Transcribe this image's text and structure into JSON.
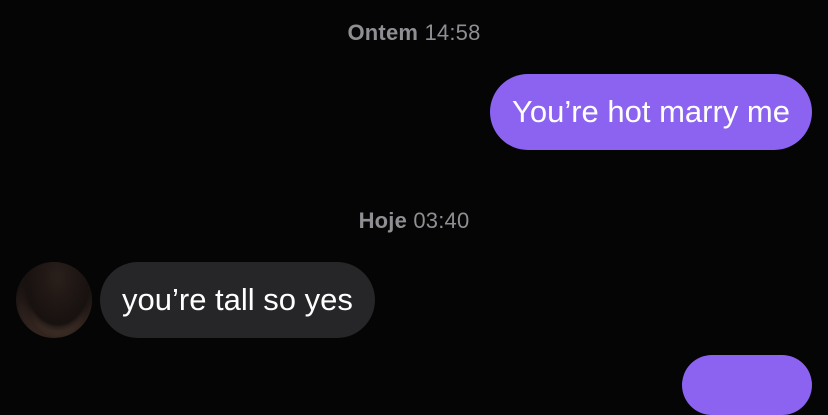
{
  "thread": {
    "separator_1": {
      "day": "Ontem",
      "time": "14:58"
    },
    "separator_2": {
      "day": "Hoje",
      "time": "03:40"
    },
    "messages": [
      {
        "direction": "outgoing",
        "text": "You’re hot marry me"
      },
      {
        "direction": "incoming",
        "text": "you’re tall so yes"
      }
    ]
  },
  "colors": {
    "background": "#050505",
    "outgoing_bubble": "#8b63f0",
    "incoming_bubble": "#262628",
    "timestamp_text": "#8e8e93"
  }
}
